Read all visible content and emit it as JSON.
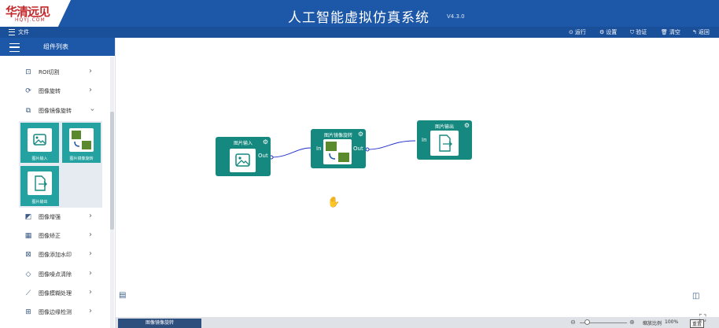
{
  "header": {
    "logo_cn": "华清远见",
    "logo_en": "HQYJ.COM",
    "title": "人工智能虚拟仿真系统",
    "version": "V4.3.0"
  },
  "menubar": {
    "file": "文件",
    "tools": [
      {
        "icon": "play-circle-icon",
        "label": "运行"
      },
      {
        "icon": "gear-icon",
        "label": "设置"
      },
      {
        "icon": "shield-icon",
        "label": "验证"
      },
      {
        "icon": "trash-icon",
        "label": "清空"
      },
      {
        "icon": "back-arrow-icon",
        "label": "返回"
      }
    ]
  },
  "sidebar": {
    "header": "组件列表",
    "items": [
      {
        "icon": "roi-crop-icon",
        "label": "ROI切割"
      },
      {
        "icon": "rotate-icon",
        "label": "图像旋转"
      },
      {
        "icon": "mirror-icon",
        "label": "图像镜像旋转",
        "expanded": true
      },
      {
        "icon": "enhance-icon",
        "label": "图像增强"
      },
      {
        "icon": "correct-icon",
        "label": "图像矫正"
      },
      {
        "icon": "watermark-icon",
        "label": "图像添加水印"
      },
      {
        "icon": "eraser-icon",
        "label": "图像噪点清除"
      },
      {
        "icon": "smooth-icon",
        "label": "图像模糊处理"
      },
      {
        "icon": "edge-icon",
        "label": "图像边缘检测"
      }
    ],
    "tiles": [
      {
        "icon": "image-icon",
        "label": "图片输入"
      },
      {
        "icon": "mirror-flip-icon",
        "label": "图片镜像旋转"
      },
      {
        "icon": "file-export-icon",
        "label": "图片输出"
      }
    ]
  },
  "canvas": {
    "nodes": [
      {
        "title": "图片输入",
        "ports": {
          "out": "Out"
        }
      },
      {
        "title": "图片镜像旋转",
        "ports": {
          "in": "In",
          "out": "Out"
        }
      },
      {
        "title": "图片输出",
        "ports": {
          "in": "In"
        }
      }
    ]
  },
  "statusbar": {
    "active_tab": "图像镜像旋转",
    "zoom_label": "缩放比例",
    "zoom_value": "100%",
    "reset": "重置"
  },
  "colors": {
    "primary": "#1c57a8",
    "node": "#15897f",
    "tile": "#24a1a1",
    "edge": "#2233cc"
  }
}
